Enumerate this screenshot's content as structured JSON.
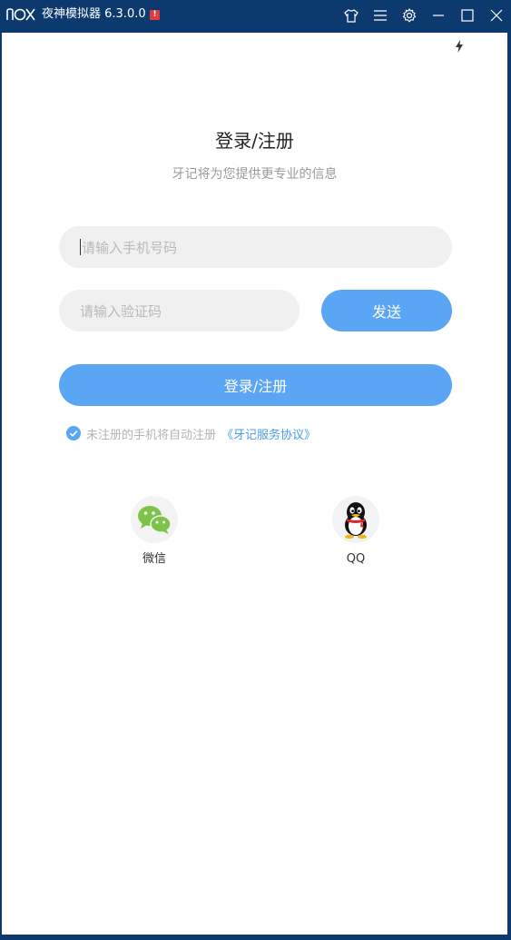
{
  "titlebar": {
    "logo_text": "nox",
    "app_title": "夜神模拟器 6.3.0.0",
    "alert_badge": "!",
    "bg_color": "#0d3a6e",
    "buttons": [
      "shirt-icon",
      "menu-icon",
      "gear-icon",
      "minimize-icon",
      "maximize-icon",
      "close-icon"
    ]
  },
  "login": {
    "title": "登录/注册",
    "subtitle": "牙记将为您提供更专业的信息",
    "phone_placeholder": "请输入手机号码",
    "code_placeholder": "请输入验证码",
    "send_label": "发送",
    "submit_label": "登录/注册",
    "agreement_text": "未注册的手机将自动注册",
    "agreement_link": "《牙记服务协议》",
    "agreement_checked": true,
    "accent_color": "#5aa6f4"
  },
  "social": [
    {
      "label": "微信",
      "icon": "wechat-icon",
      "color": "#7bc447"
    },
    {
      "label": "QQ",
      "icon": "qq-penguin-icon",
      "color": "#000000"
    }
  ]
}
